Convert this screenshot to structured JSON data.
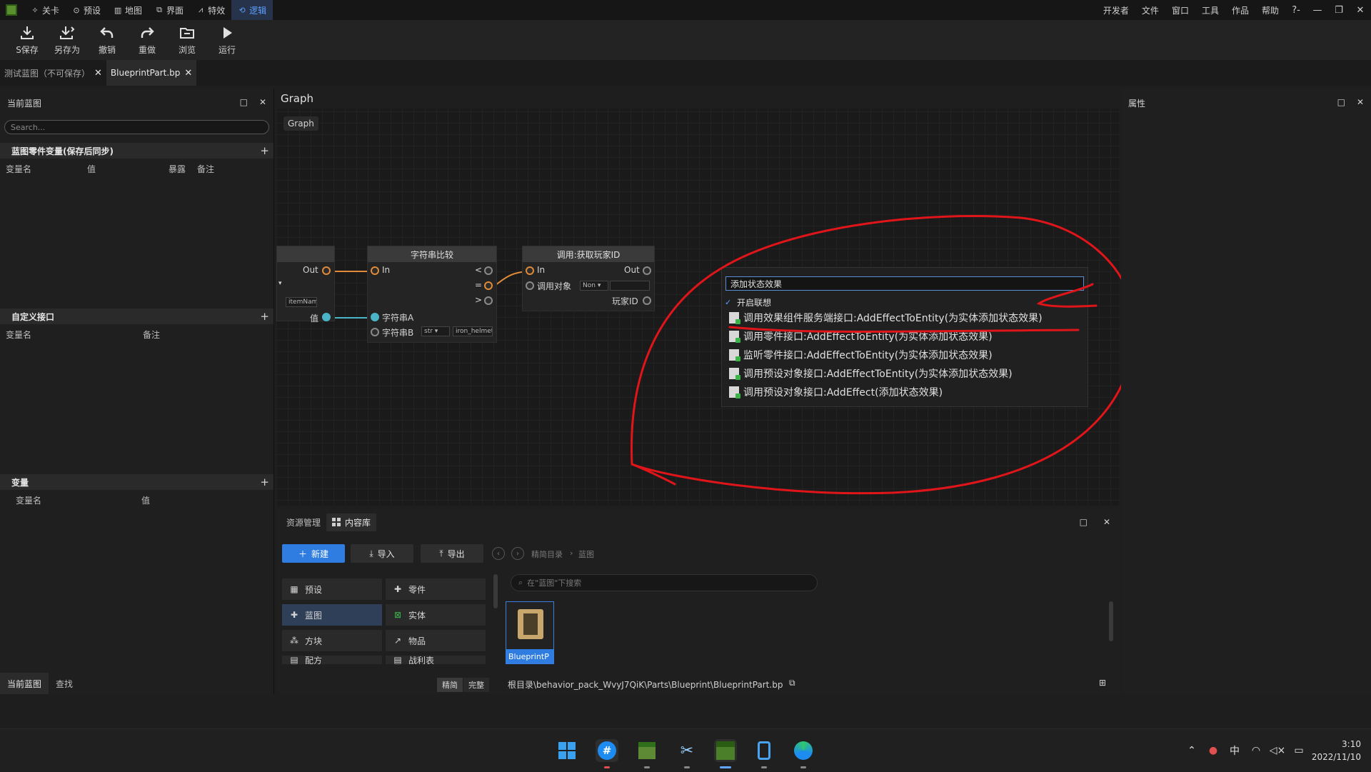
{
  "menubar": {
    "tabs": [
      {
        "label": "关卡",
        "icon": "level-icon"
      },
      {
        "label": "预设",
        "icon": "preset-icon"
      },
      {
        "label": "地图",
        "icon": "map-icon"
      },
      {
        "label": "界面",
        "icon": "ui-icon"
      },
      {
        "label": "特效",
        "icon": "effects-icon"
      },
      {
        "label": "逻辑",
        "icon": "logic-icon"
      }
    ],
    "active_tab": "逻辑",
    "right_items": [
      "开发者",
      "文件",
      "窗口",
      "工具",
      "作品",
      "帮助"
    ],
    "help_icon_text": "?-"
  },
  "toolbar": {
    "save": "S保存",
    "save_as": "另存为",
    "undo": "撤销",
    "redo": "重做",
    "browse": "浏览",
    "run": "运行"
  },
  "doc_tabs": [
    {
      "label": "测试蓝图（不可保存）"
    },
    {
      "label": "BlueprintPart.bp"
    }
  ],
  "left_panel": {
    "title": "当前蓝图",
    "search_placeholder": "Search...",
    "section_part_vars": "蓝图零件变量(保存后同步)",
    "part_var_cols": [
      "变量名",
      "值",
      "暴露",
      "备注"
    ],
    "section_custom_interface": "自定义接口",
    "interface_cols": [
      "变量名",
      "备注"
    ],
    "section_vars": "变量",
    "var_cols": [
      "变量名",
      "值"
    ],
    "bottom_tabs": [
      "当前蓝图",
      "查找"
    ]
  },
  "graph": {
    "title": "Graph",
    "breadcrumb": "Graph",
    "node_left": {
      "out_label": "Out",
      "value_label": "值",
      "field_value": "itemName"
    },
    "node_compare": {
      "title": "字符串比较",
      "in_label": "In",
      "lt": "<",
      "eq": "=",
      "gt": ">",
      "str_a": "字符串A",
      "str_b": "字符串B",
      "type_value": "str",
      "b_value": "iron_helmet"
    },
    "node_getplayer": {
      "title": "调用:获取玩家ID",
      "in_label": "In",
      "out_label": "Out",
      "target_label": "调用对象",
      "target_value": "Non",
      "player_label": "玩家ID"
    }
  },
  "popup": {
    "search_value": "添加状态效果",
    "context_label": "开启联想",
    "items": [
      "调用效果组件服务端接口:AddEffectToEntity(为实体添加状态效果)",
      "调用零件接口:AddEffectToEntity(为实体添加状态效果)",
      "监听零件接口:AddEffectToEntity(为实体添加状态效果)",
      "调用预设对象接口:AddEffectToEntity(为实体添加状态效果)",
      "调用预设对象接口:AddEffect(添加状态效果)"
    ]
  },
  "right_panel": {
    "title": "属性"
  },
  "content_lib": {
    "tabs": [
      "资源管理",
      "内容库"
    ],
    "btn_new": "新建",
    "btn_import": "导入",
    "btn_export": "导出",
    "crumb_root": "精简目录",
    "crumb_sub": "蓝图",
    "search_placeholder": "在\"蓝图\"下搜索",
    "categories": [
      "预设",
      "零件",
      "蓝图",
      "实体",
      "方块",
      "物品",
      "配方",
      "战利表"
    ],
    "asset_name": "BlueprintP",
    "view_simple": "精简",
    "view_full": "完整",
    "path": "根目录\\behavior_pack_WvyJ7QiK\\Parts\\Blueprint\\BlueprintPart.bp"
  },
  "taskbar": {
    "tray_lang": "中",
    "time": "3:10",
    "date": "2022/11/10"
  },
  "colors": {
    "accent": "#2f7de1",
    "annotation": "#e0151a",
    "exec_pin": "#e08a3a",
    "data_pin": "#4bb5c8"
  }
}
